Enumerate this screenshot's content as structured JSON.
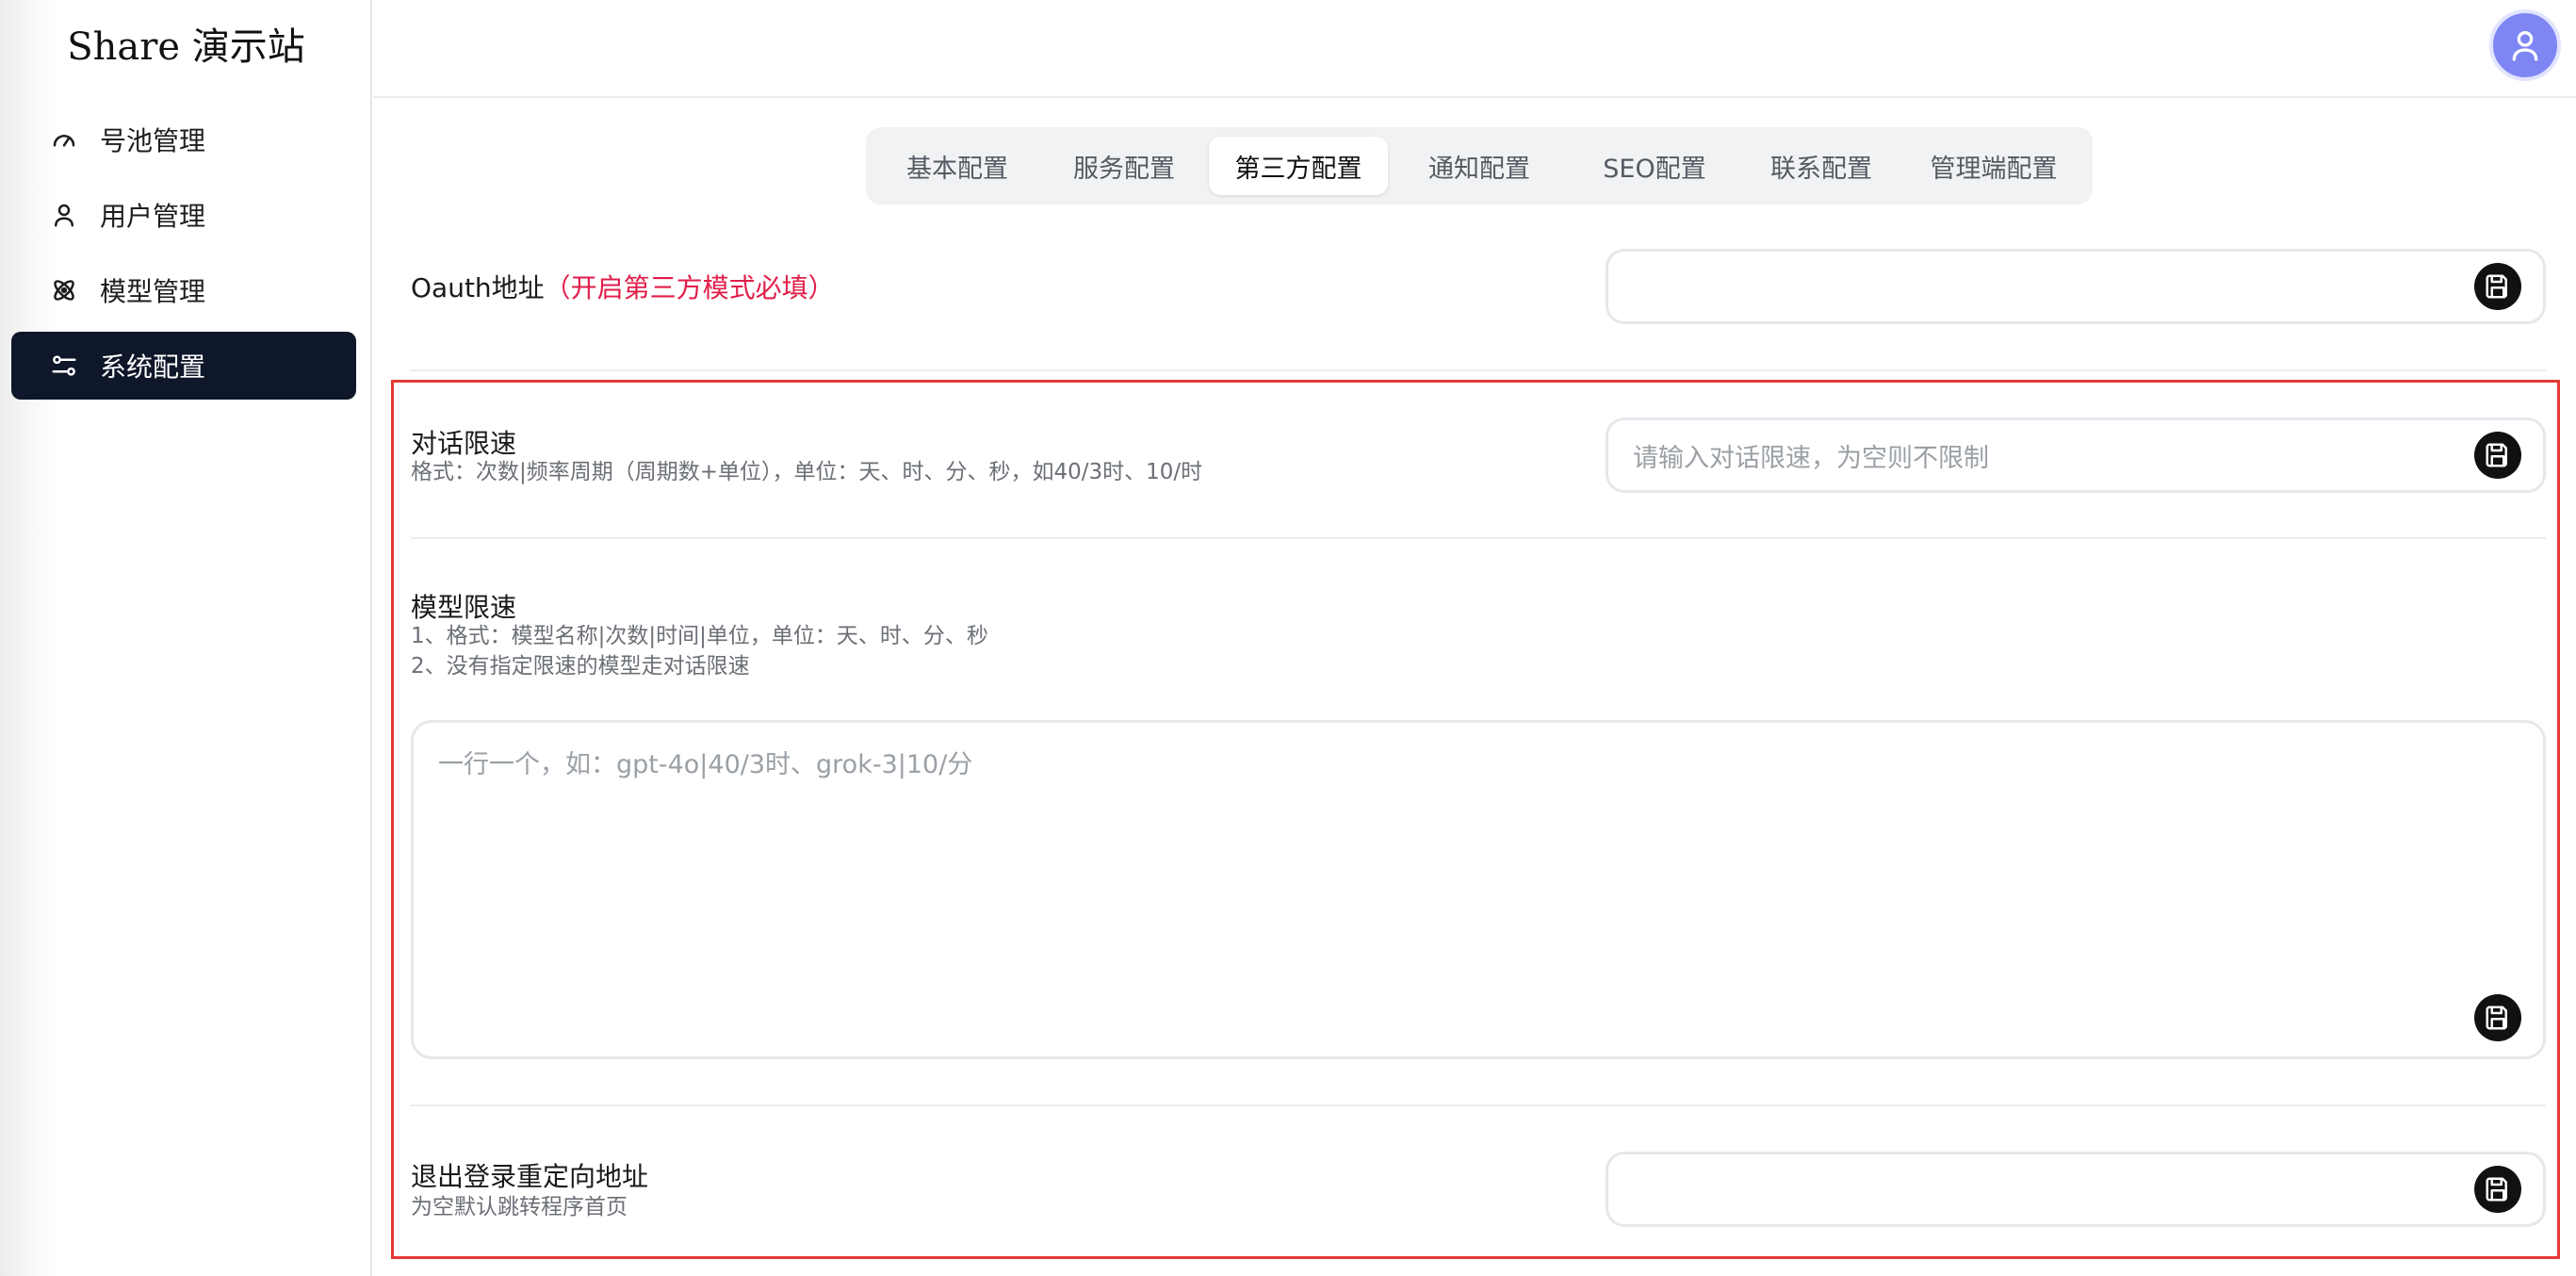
{
  "brand": "Share 演示站",
  "sidebar": {
    "items": [
      {
        "label": "号池管理",
        "icon": "gauge-icon",
        "active": false
      },
      {
        "label": "用户管理",
        "icon": "user-icon",
        "active": false
      },
      {
        "label": "模型管理",
        "icon": "model-atom-icon",
        "active": false
      },
      {
        "label": "系统配置",
        "icon": "sliders-icon",
        "active": true
      }
    ]
  },
  "tabs": [
    {
      "label": "基本配置"
    },
    {
      "label": "服务配置"
    },
    {
      "label": "第三方配置"
    },
    {
      "label": "通知配置"
    },
    {
      "label": "SEO配置"
    },
    {
      "label": "联系配置"
    },
    {
      "label": "管理端配置"
    }
  ],
  "active_tab": "第三方配置",
  "oauth": {
    "label": "Oauth地址",
    "required_note": "（开启第三方模式必填）",
    "value": ""
  },
  "chat_limit": {
    "label": "对话限速",
    "description": "格式：次数|频率周期（周期数+单位），单位：天、时、分、秒，如40/3时、10/时",
    "placeholder": "请输入对话限速，为空则不限制"
  },
  "model_limit": {
    "label": "模型限速",
    "description_1": "1、格式：模型名称|次数|时间|单位，单位：天、时、分、秒",
    "description_2": "2、没有指定限速的模型走对话限速",
    "placeholder": "一行一个，如：gpt-4o|40/3时、grok-3|10/分"
  },
  "logout_redirect": {
    "label": "退出登录重定向地址",
    "description": "为空默认跳转程序首页",
    "value": ""
  },
  "colors": {
    "sidebar_active": "#0f172a",
    "required_text": "#e11d48",
    "avatar": "#7d86f2",
    "highlight_border": "#e53935"
  }
}
